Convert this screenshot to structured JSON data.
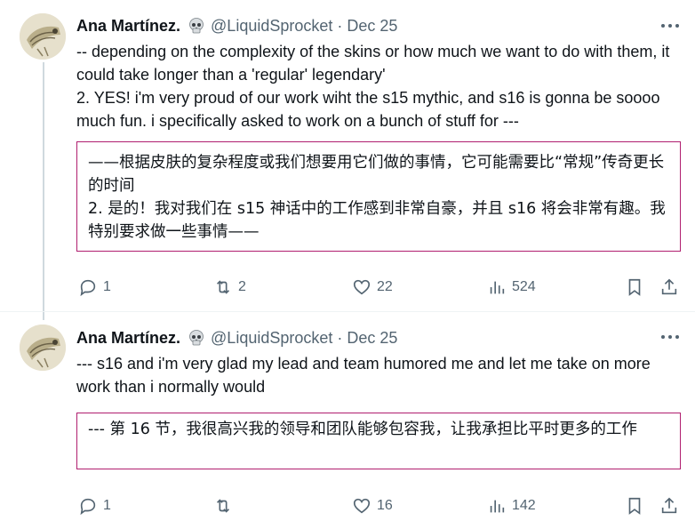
{
  "tweets": [
    {
      "author_name": "Ana Martínez.",
      "handle": "@LiquidSprocket",
      "separator": "·",
      "date": "Dec 25",
      "text": "-- depending on the complexity of the skins or how much we want to do with them, it could take longer than a 'regular' legendary'\n2. YES! i'm very proud of our work wiht the s15 mythic, and s16 is gonna be soooo much fun. i specifically asked to work on a bunch of stuff for ---",
      "translation": "——根据皮肤的复杂程度或我们想要用它们做的事情，它可能需要比“常规”传奇更长的时间\n2. 是的！我对我们在 s15 神话中的工作感到非常自豪，并且 s16 将会非常有趣。我特别要求做一些事情——",
      "replies": "1",
      "retweets": "2",
      "likes": "22",
      "views": "524"
    },
    {
      "author_name": "Ana Martínez.",
      "handle": "@LiquidSprocket",
      "separator": "·",
      "date": "Dec 25",
      "text": "--- s16 and i'm very glad my lead and team humored me and let me take on more work than i normally would",
      "translation": "--- 第 16 节，我很高兴我的领导和团队能够包容我，让我承担比平时更多的工作",
      "replies": "1",
      "retweets": "",
      "likes": "16",
      "views": "142"
    }
  ],
  "icons": {
    "more": "more-horizontal-icon",
    "reply": "reply-icon",
    "retweet": "retweet-icon",
    "like": "heart-icon",
    "views": "analytics-icon",
    "bookmark": "bookmark-icon",
    "share": "share-icon",
    "verified_emoji": "skull-icon"
  },
  "colors": {
    "translation_border": "#b01e6f",
    "secondary_text": "#536471",
    "thread_line": "#cfd9de"
  }
}
